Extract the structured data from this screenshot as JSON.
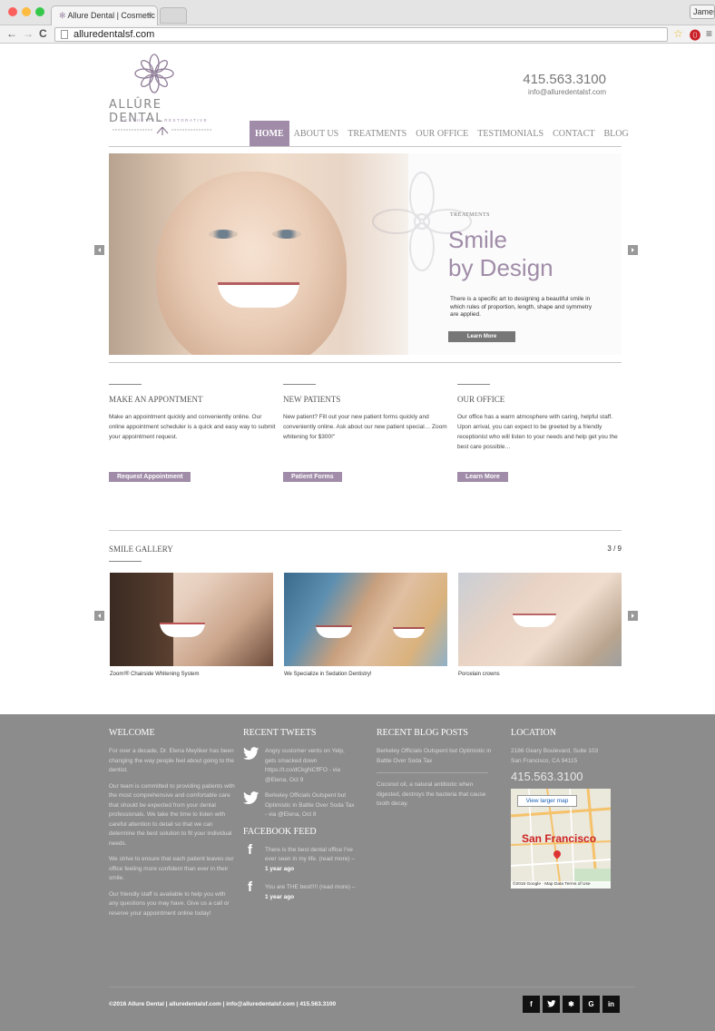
{
  "browser": {
    "tab_title": "Allure Dental | Cosmetic De",
    "tab_close": "×",
    "url": "alluredentalsf.com",
    "profile_name": "James"
  },
  "header": {
    "logo_name": "ALLÛRE DENTAL",
    "logo_tagline": "AESTHETIC + RESTORATIVE",
    "phone": "415.563.3100",
    "email": "info@alluredentalsf.com"
  },
  "nav": {
    "items": [
      "HOME",
      "ABOUT US",
      "TREATMENTS",
      "OUR OFFICE",
      "TESTIMONIALS",
      "CONTACT",
      "BLOG"
    ],
    "active": "HOME"
  },
  "hero": {
    "category": "TREATMENTS",
    "title_line1": "Smile",
    "title_line2": "by Design",
    "text": "There is a specific art to designing a beautiful smile in which rules of proportion, length, shape and symmetry are applied.",
    "button": "Learn More"
  },
  "columns": [
    {
      "title": "MAKE AN APPONTMENT",
      "text": "Make an appointment quickly and conveniently online. Our online appointment scheduler is a quick and easy way to submit your appointment request.",
      "button": "Request Appointment"
    },
    {
      "title": "NEW PATIENTS",
      "text": "New patient? Fill out your new patient forms quickly and conveniently online. Ask about our new patient special… Zoom whitening for $300!\"",
      "button": "Patient Forms"
    },
    {
      "title": "OUR OFFICE",
      "text": "Our office has a warm atmosphere with caring, helpful staff. Upon arrival, you can expect to be greeted by a friendly receptionist who will listen to your needs and help get you the best care possible…",
      "button": "Learn More"
    }
  ],
  "gallery": {
    "title": "SMILE GALLERY",
    "counter": "3 / 9",
    "captions": [
      "Zoom!® Chairside Whitening System",
      "We Specialize in Sedation Dentistry!",
      "Porcelain crowns"
    ]
  },
  "footer": {
    "welcome_title": "WELCOME",
    "welcome_paragraphs": [
      "For over a decade, Dr. Elena Meyliker has been changing the way people feel about going to the dentist.",
      "Our team is committed to providing patients with the most comprehensive and comfortable care that should be expected from your dental professionals. We take the time to listen with careful attention to detail so that we can determine the best solution to fit your individual needs.",
      "We strive to ensure that each patient leaves our office feeling more confident than ever in their smile.",
      "Our friendly staff is available to help you with any questions you may have. Give us a call or reserve your appointment online today!"
    ],
    "tweets_title": "RECENT TWEETS",
    "tweets": [
      "Angry customer vents on Yelp, gets smacked down https://t.co/dCkgNCffFO - via @Elena, Oct 9",
      "Berkeley Officials Outspent but Optimistic in Battle Over Soda Tax - via @Elena, Oct 8"
    ],
    "facebook_title": "FACEBOOK FEED",
    "facebook": [
      {
        "text": "There is the best dental office I've ever seen in my life. (read more) – ",
        "time": "1 year ago"
      },
      {
        "text": "You are THE best!!!! (read more) – ",
        "time": "1 year ago"
      }
    ],
    "blog_title": "RECENT BLOG POSTS",
    "blog_posts": [
      "Berkeley Officials Outspent but Optimistic in Battle Over Soda Tax",
      "Coconut oil, a natural antibiotic when digested, destroys the bacteria that cause tooth decay."
    ],
    "location_title": "LOCATION",
    "address_line1": "2186 Geary Boulevard, Suite 103",
    "address_line2": "San Francisco, CA 94115",
    "phone": "415.563.3100",
    "map_button": "View larger map",
    "map_city": "San Francisco",
    "map_footer": "©2016 Google · Map Data   Terms of Use",
    "copyright": "©2016 Allure Dental  |  alluredentalsf.com  |  info@alluredentalsf.com  |  415.563.3100",
    "social": [
      "f",
      "t",
      "yelp",
      "G",
      "in"
    ]
  },
  "colors": {
    "accent": "#a08ca8",
    "footer_bg": "#8c8c8c",
    "text": "#444444"
  }
}
